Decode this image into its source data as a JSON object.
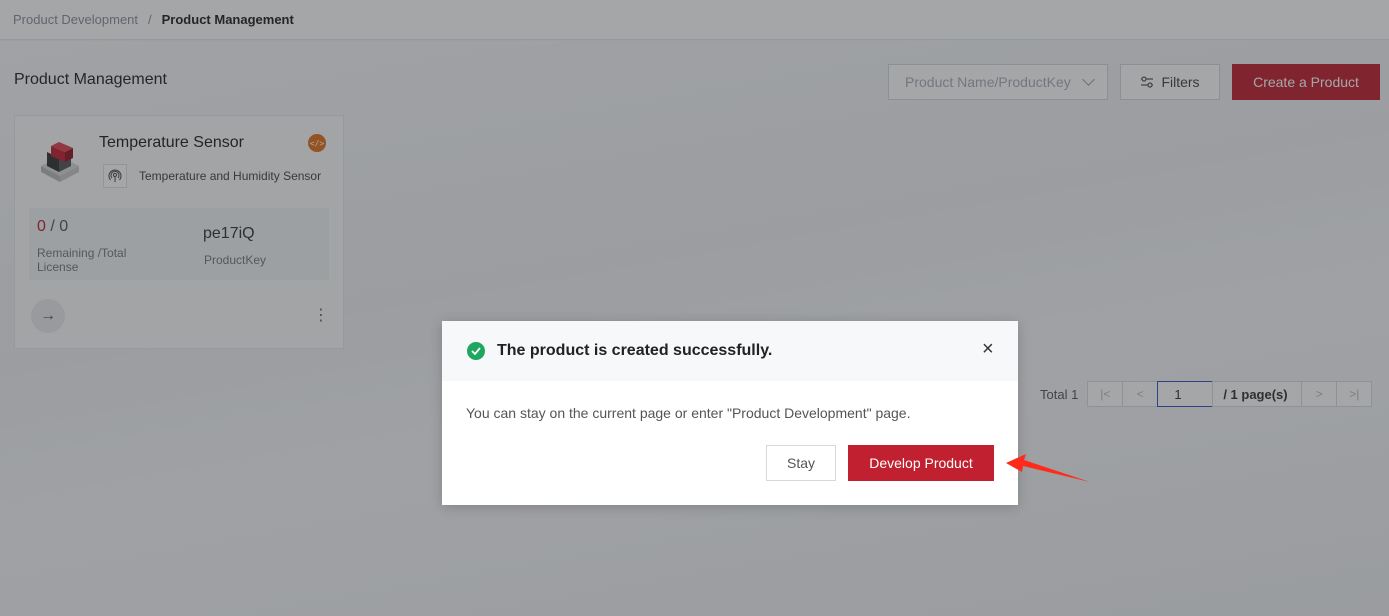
{
  "breadcrumb": {
    "parent": "Product Development",
    "separator": "/",
    "current": "Product Management"
  },
  "header": {
    "title": "Product Management",
    "search_placeholder": "Product Name/ProductKey",
    "filters_label": "Filters",
    "create_label": "Create a Product"
  },
  "card": {
    "name": "Temperature Sensor",
    "category": "Temperature and Humidity Sensor",
    "license_remaining": "0",
    "license_sep": " / ",
    "license_total": "0",
    "license_label": "Remaining /Total License",
    "product_key": "pe17iQ",
    "product_key_label": "ProductKey",
    "icon": "product-device-icon",
    "badge_icon": "code-icon"
  },
  "pagination": {
    "total_label": "Total 1",
    "current_page": "1",
    "pages_label": "/ 1 page(s)"
  },
  "dialog": {
    "title": "The product is created successfully.",
    "message": "You can stay on the current page or enter \"Product Development\" page.",
    "stay_label": "Stay",
    "develop_label": "Develop Product",
    "close_glyph": "×"
  },
  "colors": {
    "brand": "#c0202f",
    "success": "#1fa661",
    "annotation": "#ff2a1a"
  }
}
